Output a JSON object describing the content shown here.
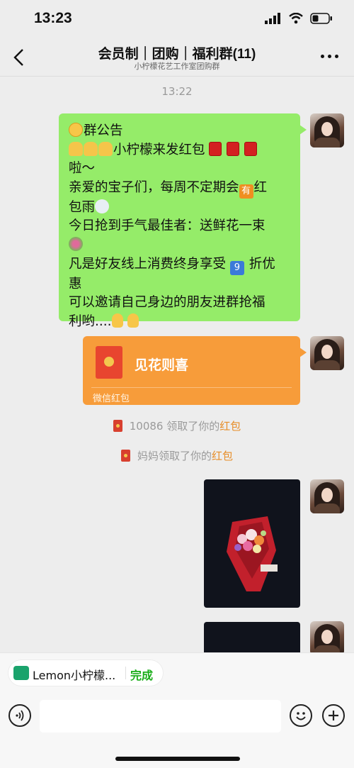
{
  "status_bar": {
    "time": "13:23"
  },
  "nav": {
    "title": "会员制｜团购｜福利群(11)",
    "subtitle": "小柠檬花艺工作室团购群"
  },
  "chat": {
    "timestamp": "13:22",
    "announcement_lines": [
      "群公告",
      "小柠檬来发红包",
      "啦～",
      "亲爱的宝子们，每周不定期会",
      "红",
      "包雨",
      "今日抢到手气最佳者：送鲜花一束",
      "凡是好友线上消费终身享受",
      "折优",
      "惠",
      "可以邀请自己身边的朋友进群抢福",
      "利哟...."
    ],
    "emoji_texts": {
      "you": "有",
      "nine": "9"
    },
    "red_packet": {
      "title": "见花则喜",
      "label": "微信红包"
    },
    "system_messages": [
      {
        "prefix": "10086 领取了你的",
        "highlight": "红包"
      },
      {
        "prefix": "妈妈领取了你的",
        "highlight": "红包"
      }
    ]
  },
  "bottom": {
    "mini_program_chip": {
      "label": "Lemon小柠檬...",
      "done": "完成"
    }
  },
  "colors": {
    "bubble_green": "#95ec69",
    "red_packet_orange": "#f79c3a",
    "highlight": "#e78d27",
    "done_green": "#1aad19"
  }
}
